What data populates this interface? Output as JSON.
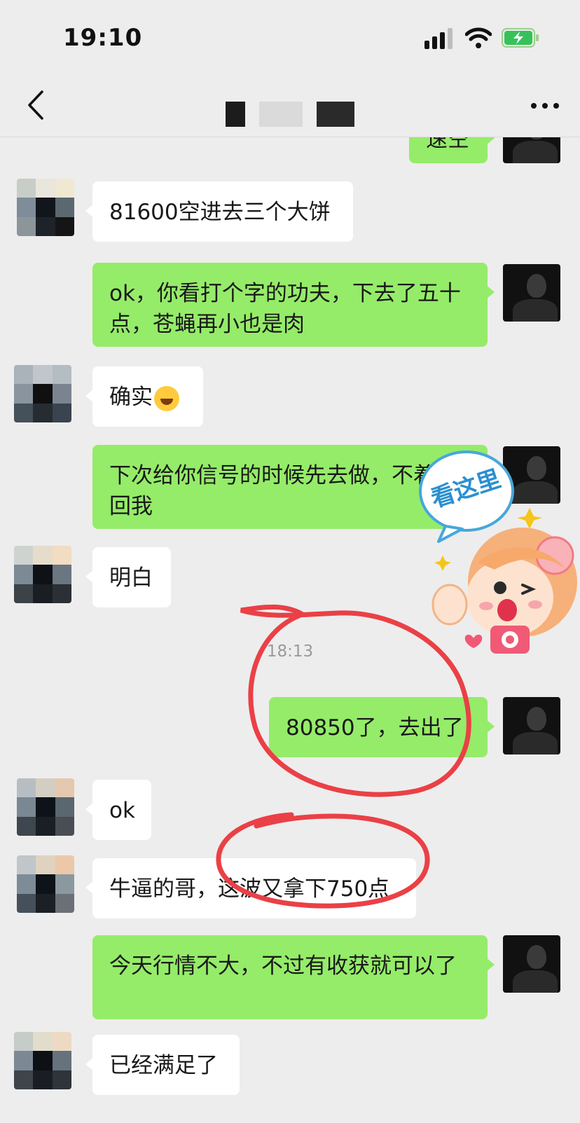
{
  "status_bar": {
    "time": "19:10",
    "icons": [
      "cellular-signal-icon",
      "wifi-icon",
      "battery-charging-icon"
    ]
  },
  "nav": {
    "back_icon": "chevron-left-icon",
    "more_icon": "ellipsis-icon"
  },
  "messages": [
    {
      "side": "out",
      "text": "速空"
    },
    {
      "side": "in",
      "text": "81600空进去三个大饼"
    },
    {
      "side": "out",
      "text": "ok，你看打个字的功夫，下去了五十点，苍蝇再小也是肉"
    },
    {
      "side": "in",
      "text": "确实"
    },
    {
      "side": "out",
      "text": "下次给你信号的时候先去做，不着急回我"
    },
    {
      "side": "in",
      "text": "明白"
    },
    {
      "side": "out",
      "text": "80850了，去出了"
    },
    {
      "side": "in",
      "text": "ok"
    },
    {
      "side": "in",
      "text": "牛逼的哥，这波又拿下750点"
    },
    {
      "side": "out",
      "text": "今天行情不大，不过有收获就可以了"
    },
    {
      "side": "in",
      "text": "已经满足了"
    }
  ],
  "timestamp": "18:13",
  "sticker": {
    "text": "看这里",
    "icon": "cartoon-girl-camera-sticker"
  },
  "colors": {
    "background": "#ededed",
    "bubble_out": "#95ec69",
    "bubble_in": "#ffffff",
    "annotation_red": "#ea4046"
  }
}
